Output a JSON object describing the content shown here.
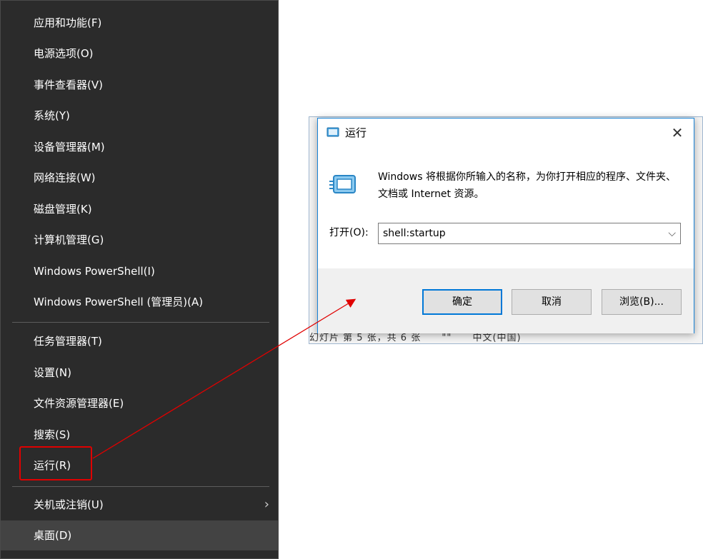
{
  "winx_menu": {
    "items": [
      {
        "label": "应用和功能(F)"
      },
      {
        "label": "电源选项(O)"
      },
      {
        "label": "事件查看器(V)"
      },
      {
        "label": "系统(Y)"
      },
      {
        "label": "设备管理器(M)"
      },
      {
        "label": "网络连接(W)"
      },
      {
        "label": "磁盘管理(K)"
      },
      {
        "label": "计算机管理(G)"
      },
      {
        "label": "Windows PowerShell(I)"
      },
      {
        "label": "Windows PowerShell (管理员)(A)"
      },
      {
        "label": "任务管理器(T)"
      },
      {
        "label": "设置(N)"
      },
      {
        "label": "文件资源管理器(E)"
      },
      {
        "label": "搜索(S)"
      },
      {
        "label": "运行(R)"
      },
      {
        "label": "关机或注销(U)"
      },
      {
        "label": "桌面(D)"
      }
    ],
    "submenu_arrow": "›"
  },
  "background_status": {
    "parts": [
      "幻灯片 第 5 张，共 6 张",
      "\"\"",
      "中文(中国)"
    ]
  },
  "run_dialog": {
    "title": "运行",
    "close_glyph": "✕",
    "description": "Windows 将根据你所输入的名称，为你打开相应的程序、文件夹、文档或 Internet 资源。",
    "open_label": "打开(O):",
    "open_value": "shell:startup",
    "dropdown_glyph": "⌵",
    "ok_label": "确定",
    "cancel_label": "取消",
    "browse_label": "浏览(B)..."
  },
  "colors": {
    "menu_bg": "#2b2b2b",
    "menu_highlight": "#434343",
    "accent": "#0078d7",
    "annotation_red": "#e00000"
  }
}
